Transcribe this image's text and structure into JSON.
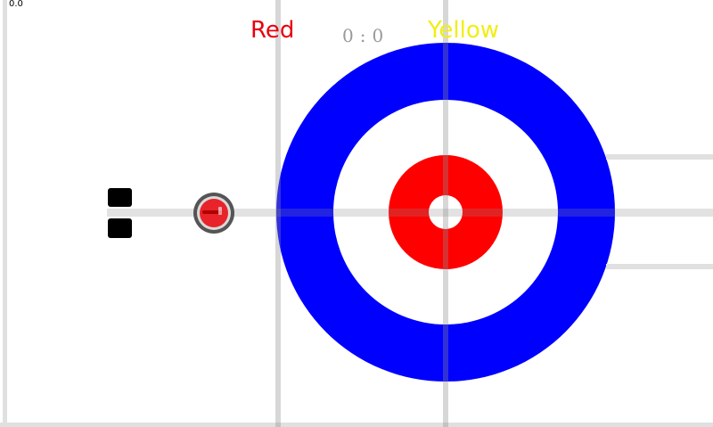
{
  "hud": {
    "fps": "0.0",
    "team_red": "Red",
    "team_yellow": "Yellow",
    "score_red": "0",
    "score_sep": ":",
    "score_yellow": "0"
  },
  "colors": {
    "red_team": "#e8000e",
    "yellow_team": "#f2ee14",
    "house_blue": "#0000ff",
    "house_red": "#ff0000",
    "ice": "#ffffff",
    "line": "#d8d8d8",
    "stone_body": "#555555",
    "stone_top": "#e8242a",
    "hack": "#000000"
  }
}
